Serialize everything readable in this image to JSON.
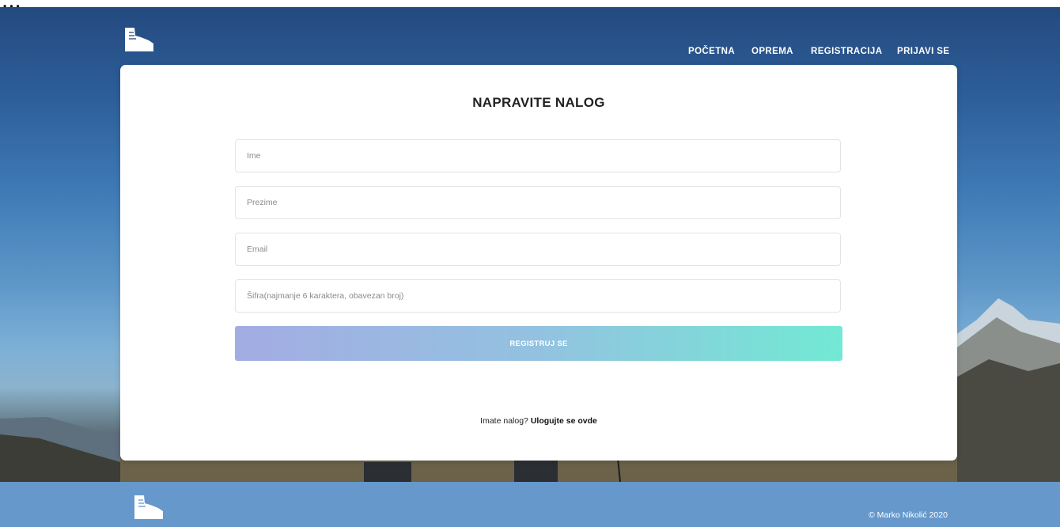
{
  "top_strip_text": "...",
  "header": {
    "logo_icon": "hiking-boot-icon",
    "nav": [
      {
        "label": "POČETNA"
      },
      {
        "label": "OPREMA"
      },
      {
        "label": "REGISTRACIJA"
      },
      {
        "label": "PRIJAVI SE"
      }
    ]
  },
  "form": {
    "title": "NAPRAVITE NALOG",
    "fields": [
      {
        "placeholder": "Ime",
        "value": ""
      },
      {
        "placeholder": "Prezime",
        "value": ""
      },
      {
        "placeholder": "Email",
        "value": ""
      },
      {
        "placeholder": "Šifra(najmanje 6 karaktera, obavezan broj)",
        "value": ""
      }
    ],
    "submit_label": "REGISTRUJ SE",
    "login_prompt": "Imate nalog?",
    "login_link": "Ulogujte se ovde"
  },
  "footer": {
    "logo_icon": "hiking-boot-icon",
    "copyright": "© Marko Nikolić 2020"
  },
  "colors": {
    "footer_bg": "#6698cc",
    "button_gradient_start": "#a3ace3",
    "button_gradient_end": "#72e9d4"
  }
}
